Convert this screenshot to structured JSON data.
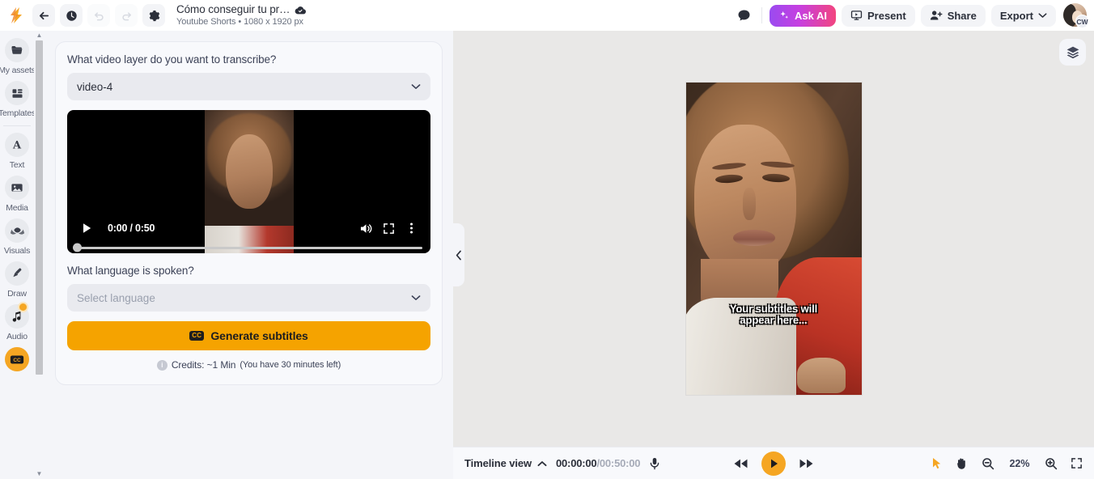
{
  "header": {
    "logo_icon": "app-logo-icon",
    "back_icon": "back-arrow-icon",
    "history_icon": "clock-history-icon",
    "undo_icon": "undo-icon",
    "redo_icon": "redo-icon",
    "settings_icon": "gear-icon",
    "doc_title": "Cómo conseguir tu pr…",
    "cloud_icon": "cloud-saved-icon",
    "doc_subtitle": "Youtube Shorts • 1080 x 1920 px",
    "comment_icon": "comment-icon",
    "ask_ai_label": "Ask AI",
    "ask_ai_icon": "sparkle-icon",
    "present_label": "Present",
    "present_icon": "present-screen-icon",
    "share_label": "Share",
    "share_icon": "person-add-icon",
    "export_label": "Export",
    "export_icon": "chevron-down-icon",
    "avatar_initials": "CW"
  },
  "sidebar": {
    "items": [
      {
        "label": "My assets",
        "icon": "folder-icon",
        "accent": false
      },
      {
        "label": "Templates",
        "icon": "templates-grid-icon",
        "accent": false
      },
      {
        "label": "Text",
        "icon": "text-a-icon",
        "accent": false
      },
      {
        "label": "Media",
        "icon": "image-icon",
        "accent": false
      },
      {
        "label": "Visuals",
        "icon": "visuals-lotus-icon",
        "accent": false
      },
      {
        "label": "Draw",
        "icon": "brush-icon",
        "accent": false
      },
      {
        "label": "Audio",
        "icon": "music-note-icon",
        "accent": false
      },
      {
        "label": "",
        "icon": "closed-caption-icon",
        "accent": true
      }
    ],
    "scroll_up_icon": "scroll-up-arrow-icon",
    "scroll_down_icon": "scroll-down-arrow-icon"
  },
  "panel": {
    "video_layer_label": "What video layer do you want to transcribe?",
    "video_layer_value": "video-4",
    "video_layer_chevron": "chevron-down-icon",
    "player": {
      "play_icon": "play-icon",
      "time": "0:00 / 0:50",
      "volume_icon": "volume-icon",
      "fullscreen_icon": "fullscreen-icon",
      "more_icon": "kebab-menu-icon"
    },
    "language_label": "What language is spoken?",
    "language_placeholder": "Select language",
    "language_chevron": "chevron-down-icon",
    "generate_label": "Generate subtitles",
    "generate_icon": "cc-icon",
    "generate_badge": "CC",
    "credits_icon": "info-icon",
    "credits_main": "Credits: ~1 Min",
    "credits_sub": "(You have 30 minutes left)"
  },
  "collapse": {
    "icon": "chevron-left-icon"
  },
  "canvas": {
    "layers_icon": "layers-icon",
    "subtitle_line1": "Your subtitles will",
    "subtitle_line2": "appear here..."
  },
  "timeline": {
    "view_label": "Timeline view",
    "view_chevron": "chevron-up-icon",
    "current_time": "00:00:00",
    "time_separator": "/",
    "total_time": "00:50:00",
    "mic_icon": "microphone-icon",
    "rewind_icon": "rewind-icon",
    "play_icon": "play-icon",
    "forward_icon": "fast-forward-icon",
    "pointer_icon": "pointer-tool-icon",
    "hand_icon": "hand-tool-icon",
    "zoom_out_icon": "zoom-out-icon",
    "zoom_level": "22%",
    "zoom_in_icon": "zoom-in-icon",
    "fit_icon": "fit-screen-icon"
  },
  "colors": {
    "accent_orange": "#f5a623",
    "generate_orange": "#f5a300",
    "panel_bg": "#f4f5f9",
    "canvas_bg": "#e9e8e7"
  }
}
